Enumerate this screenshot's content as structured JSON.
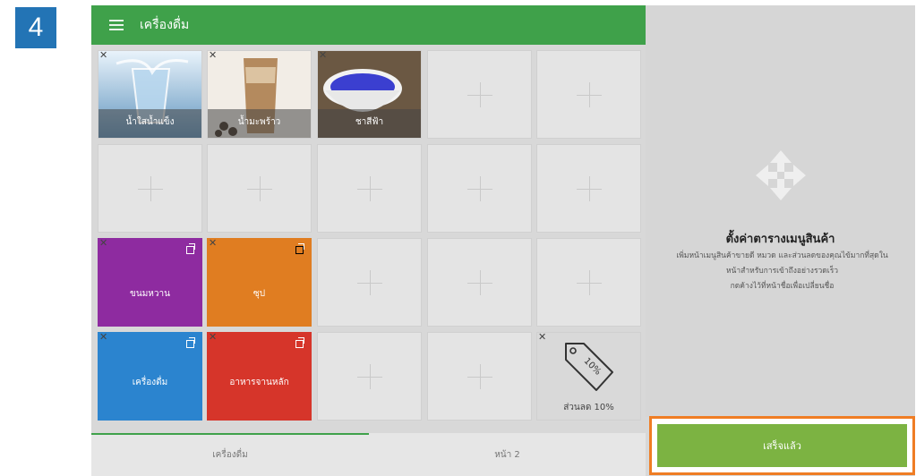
{
  "step": "4",
  "header": {
    "title": "เครื่องดื่ม",
    "menu_icon": "hamburger-icon"
  },
  "grid": {
    "items": [
      {
        "label": "น้ำใสน้ำแข็ง",
        "type": "product"
      },
      {
        "label": "น้ำมะพร้าว",
        "type": "product"
      },
      {
        "label": "ชาสีฟ้า",
        "type": "product"
      },
      {
        "label": "ขนมหวาน",
        "type": "category",
        "color": "#8e2ba0"
      },
      {
        "label": "ซุป",
        "type": "category",
        "color": "#e07d21"
      },
      {
        "label": "เครื่องดื่ม",
        "type": "category",
        "color": "#2b84cf"
      },
      {
        "label": "อาหารจานหลัก",
        "type": "category",
        "color": "#d6352a"
      },
      {
        "label": "ส่วนลด 10%",
        "type": "discount",
        "tag_text": "10%"
      }
    ]
  },
  "tabs": [
    {
      "label": "เครื่องดื่ม",
      "active": true
    },
    {
      "label": "หน้า 2",
      "active": false
    }
  ],
  "panel": {
    "title": "ตั้งค่าตารางเมนูสินค้า",
    "line1": "เพิ่มหน้าเมนูสินค้าขายดี หมวด และส่วนลดของคุณไข้มากที่สุดใน",
    "line2": "หน้าสำหรับการเข้าถึงอย่างรวดเร็ว",
    "line3": "กดค้างไว้ที่หน้าชื่อเพื่อเปลี่ยนชื่อ"
  },
  "done_button": "เสร็จแล้ว",
  "colors": {
    "appbar": "#3fa14a",
    "done": "#7cb342",
    "highlight": "#ef7d24"
  }
}
